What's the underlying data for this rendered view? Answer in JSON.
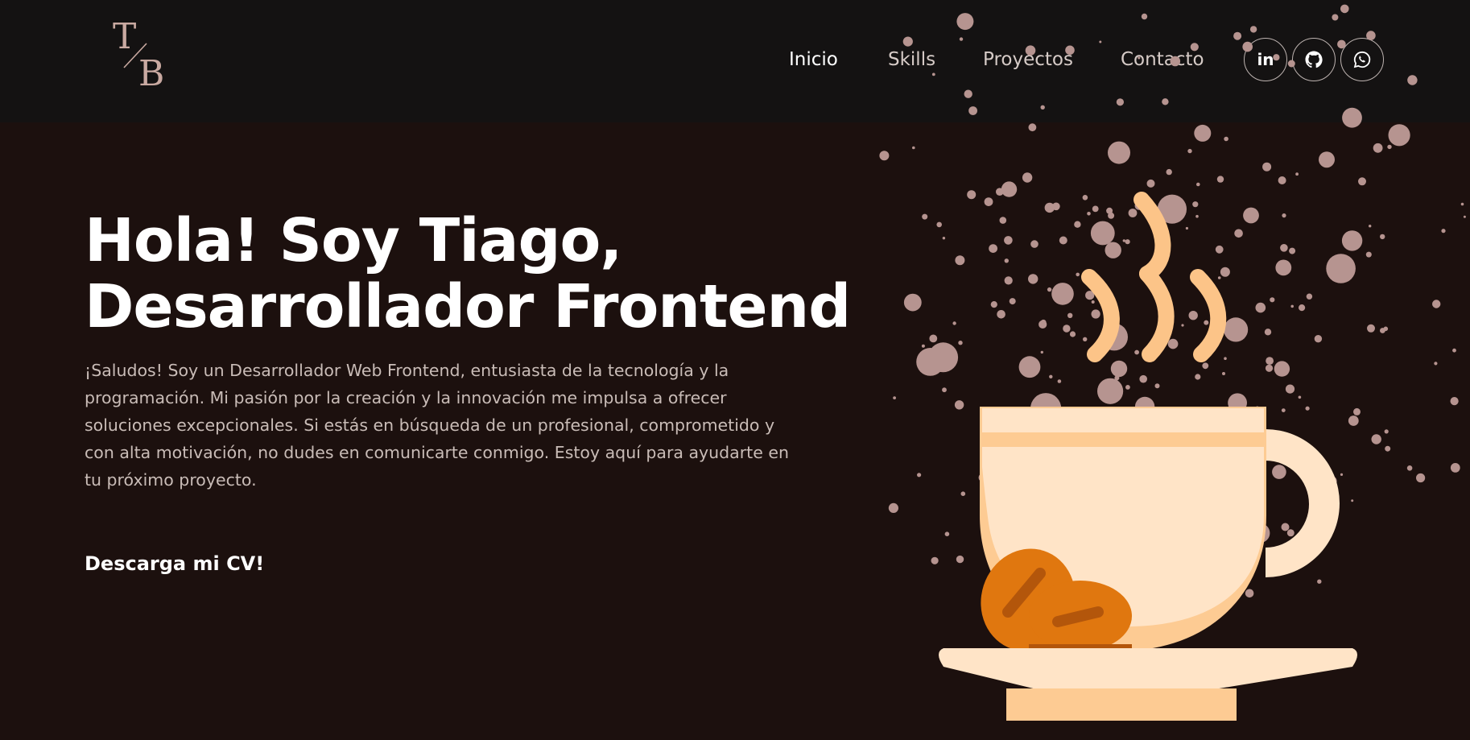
{
  "logo": {
    "top_letter": "T",
    "bottom_letter": "B"
  },
  "nav": {
    "items": [
      {
        "label": "Inicio",
        "active": true
      },
      {
        "label": "Skills",
        "active": false
      },
      {
        "label": "Proyectos",
        "active": false
      },
      {
        "label": "Contacto",
        "active": false
      }
    ]
  },
  "social": [
    {
      "icon": "linkedin-icon",
      "label": "in"
    },
    {
      "icon": "github-icon"
    },
    {
      "icon": "whatsapp-icon"
    }
  ],
  "hero": {
    "title_line1": "Hola! Soy Tiago,",
    "title_line2": "Desarrollador Frontend",
    "text": "¡Saludos! Soy un Desarrollador Web Frontend, entusiasta de la tecnología y la programación. Mi pasión por la creación y la innovación me impulsa a ofrecer soluciones excepcionales. Si estás en búsqueda de un profesional, comprometido y con alta motivación, no dudes en comunicarte conmigo. Estoy aquí para ayudarte en tu próximo proyecto.",
    "cv_button": "Descarga mi CV!"
  },
  "colors": {
    "topbar_bg": "#141212",
    "page_bg": "#1c100e",
    "logo": "#c9a9a1",
    "cup": "#ffe4c7",
    "cup_shadow": "#fdcb93",
    "steam": "#fcc488",
    "beans": "#e0770f",
    "beans_dark": "#b3560b",
    "splatter": "#b69490"
  }
}
